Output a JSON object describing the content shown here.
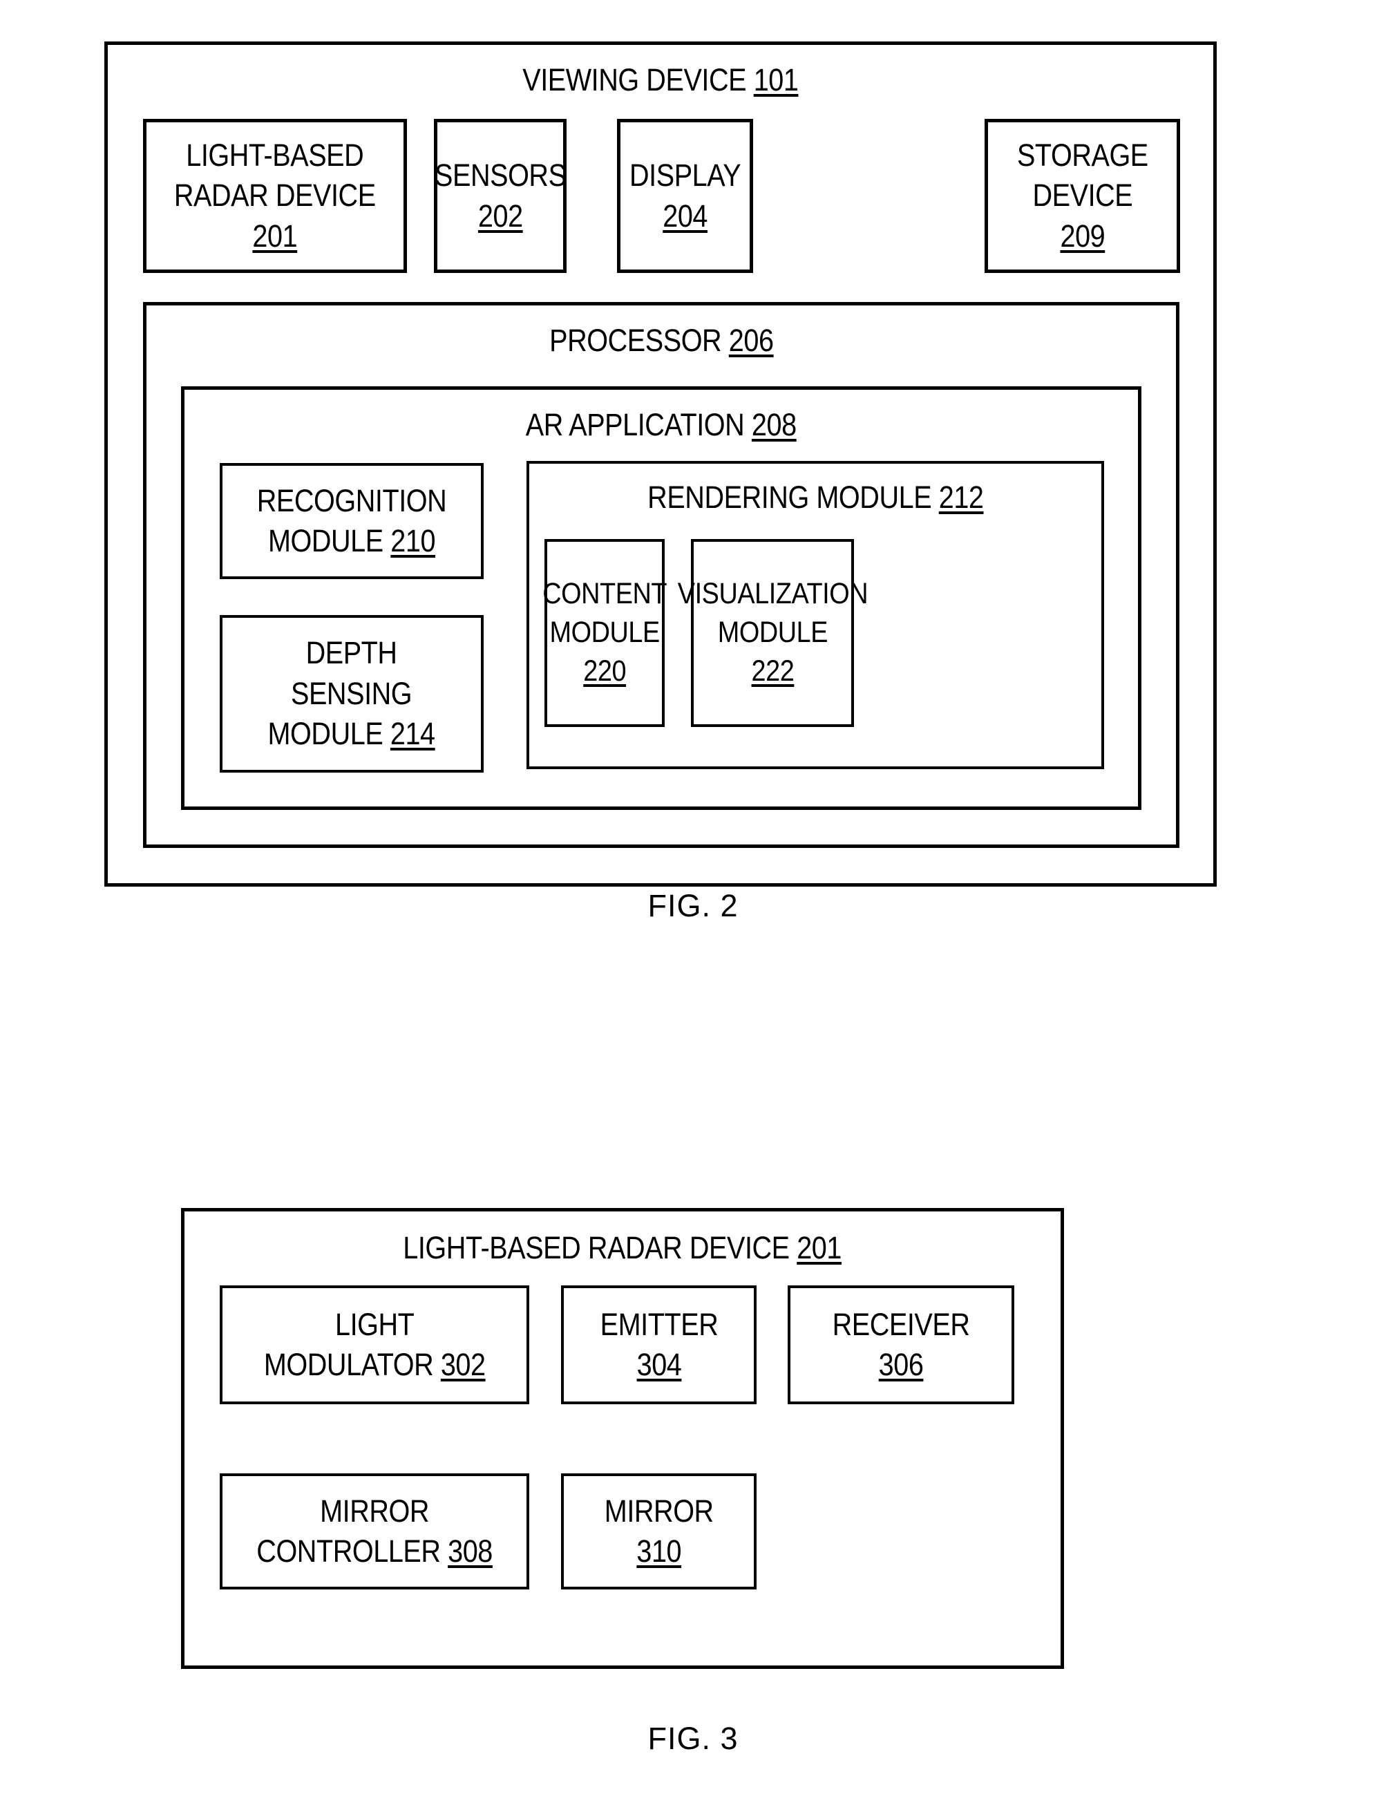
{
  "figures": [
    {
      "caption": "FIG. 2",
      "frame_title": "VIEWING DEVICE",
      "frame_num": "101",
      "components": [
        {
          "name": "light-based-radar-device",
          "lines": [
            "LIGHT-BASED",
            "RADAR DEVICE"
          ],
          "num": "201",
          "num_on_own_line": true
        },
        {
          "name": "sensors",
          "lines": [
            "SENSORS"
          ],
          "num": "202",
          "num_on_own_line": true
        },
        {
          "name": "display",
          "lines": [
            "DISPLAY"
          ],
          "num": "204",
          "num_on_own_line": true
        },
        {
          "name": "storage-device",
          "lines": [
            "STORAGE",
            "DEVICE"
          ],
          "num": "209",
          "num_on_own_line": true
        },
        {
          "name": "processor",
          "lines": [
            "PROCESSOR"
          ],
          "num": "206",
          "num_on_own_line": false
        },
        {
          "name": "ar-application",
          "lines": [
            "AR APPLICATION"
          ],
          "num": "208",
          "num_on_own_line": false
        },
        {
          "name": "recognition-module",
          "lines": [
            "RECOGNITION",
            "MODULE"
          ],
          "num": "210",
          "num_on_own_line": false
        },
        {
          "name": "depth-sensing-module",
          "lines": [
            "DEPTH",
            "SENSING",
            "MODULE"
          ],
          "num": "214",
          "num_on_own_line": false
        },
        {
          "name": "rendering-module",
          "lines": [
            "RENDERING MODULE"
          ],
          "num": "212",
          "num_on_own_line": false
        },
        {
          "name": "content-module",
          "lines": [
            "CONTENT",
            "MODULE"
          ],
          "num": "220",
          "num_on_own_line": true
        },
        {
          "name": "visualization-module",
          "lines": [
            "VISUALIZATION",
            "MODULE"
          ],
          "num": "222",
          "num_on_own_line": true
        }
      ]
    },
    {
      "caption": "FIG. 3",
      "frame_title": "LIGHT-BASED RADAR DEVICE",
      "frame_num": "201",
      "components": [
        {
          "name": "light-modulator",
          "lines": [
            "LIGHT",
            "MODULATOR"
          ],
          "num": "302",
          "num_on_own_line": false
        },
        {
          "name": "emitter",
          "lines": [
            "EMITTER"
          ],
          "num": "304",
          "num_on_own_line": true
        },
        {
          "name": "receiver",
          "lines": [
            "RECEIVER"
          ],
          "num": "306",
          "num_on_own_line": true
        },
        {
          "name": "mirror-controller",
          "lines": [
            "MIRROR",
            "CONTROLLER"
          ],
          "num": "308",
          "num_on_own_line": false
        },
        {
          "name": "mirror",
          "lines": [
            "MIRROR"
          ],
          "num": "310",
          "num_on_own_line": true
        }
      ]
    }
  ],
  "fig2": {
    "frame": {
      "title": "VIEWING DEVICE",
      "num": "101"
    },
    "radar": {
      "l1": "LIGHT-BASED",
      "l2": "RADAR DEVICE",
      "num": "201"
    },
    "sensors": {
      "l1": "SENSORS",
      "num": "202"
    },
    "display": {
      "l1": "DISPLAY",
      "num": "204"
    },
    "storage": {
      "l1": "STORAGE",
      "l2": "DEVICE",
      "num": "209"
    },
    "processor": {
      "title": "PROCESSOR",
      "num": "206"
    },
    "ar_application": {
      "title": "AR APPLICATION",
      "num": "208"
    },
    "recognition": {
      "l1": "RECOGNITION",
      "l2": "MODULE",
      "num": "210"
    },
    "depth": {
      "l1": "DEPTH",
      "l2": "SENSING",
      "l3": "MODULE",
      "num": "214"
    },
    "rendering": {
      "title": "RENDERING MODULE",
      "num": "212"
    },
    "content": {
      "l1": "CONTENT",
      "l2": "MODULE",
      "num": "220"
    },
    "visualization": {
      "l1": "VISUALIZATION",
      "l2": "MODULE",
      "num": "222"
    },
    "caption": "FIG. 2"
  },
  "fig3": {
    "frame": {
      "title": "LIGHT-BASED RADAR DEVICE",
      "num": "201"
    },
    "modulator": {
      "l1": "LIGHT",
      "l2": "MODULATOR",
      "num": "302"
    },
    "emitter": {
      "l1": "EMITTER",
      "num": "304"
    },
    "receiver": {
      "l1": "RECEIVER",
      "num": "306"
    },
    "mirror_controller": {
      "l1": "MIRROR",
      "l2": "CONTROLLER",
      "num": "308"
    },
    "mirror": {
      "l1": "MIRROR",
      "num": "310"
    },
    "caption": "FIG. 3"
  },
  "colors": {
    "stroke": "#000000",
    "background": "#ffffff"
  }
}
